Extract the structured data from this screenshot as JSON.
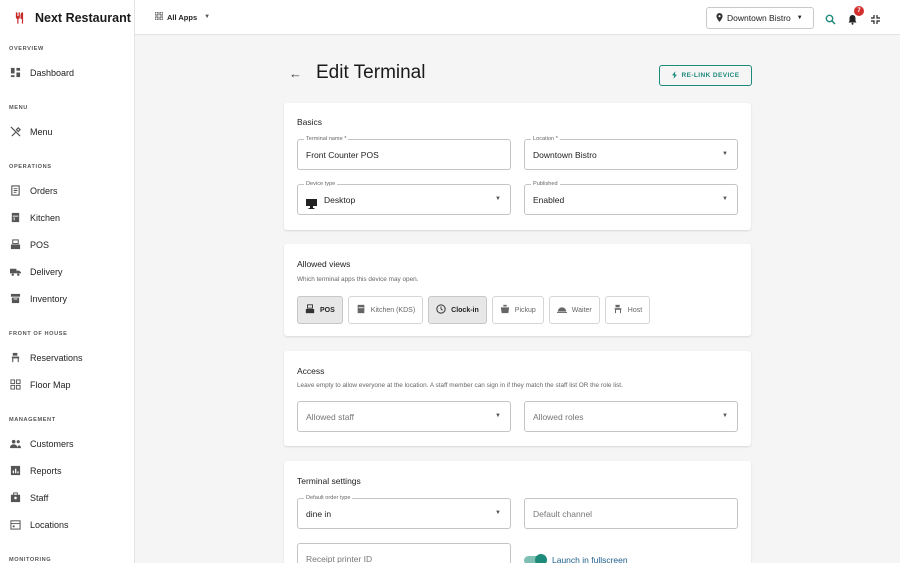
{
  "app": {
    "name": "Next Restaurant"
  },
  "topbar": {
    "apps_label": "All Apps",
    "location": "Downtown Bistro",
    "notifications_count": "7"
  },
  "sidebar": {
    "sections": [
      {
        "label": "OVERVIEW",
        "items": [
          {
            "label": "Dashboard",
            "icon": "dashboard-icon"
          }
        ]
      },
      {
        "label": "MENU",
        "items": [
          {
            "label": "Menu",
            "icon": "utensils-icon"
          }
        ]
      },
      {
        "label": "OPERATIONS",
        "items": [
          {
            "label": "Orders",
            "icon": "receipt-icon"
          },
          {
            "label": "Kitchen",
            "icon": "kitchen-icon"
          },
          {
            "label": "POS",
            "icon": "pos-icon"
          },
          {
            "label": "Delivery",
            "icon": "truck-icon"
          },
          {
            "label": "Inventory",
            "icon": "inventory-icon"
          }
        ]
      },
      {
        "label": "FRONT OF HOUSE",
        "items": [
          {
            "label": "Reservations",
            "icon": "reservation-icon"
          },
          {
            "label": "Floor Map",
            "icon": "floor-map-icon"
          }
        ]
      },
      {
        "label": "MANAGEMENT",
        "items": [
          {
            "label": "Customers",
            "icon": "customers-icon"
          },
          {
            "label": "Reports",
            "icon": "reports-icon"
          },
          {
            "label": "Staff",
            "icon": "staff-icon"
          },
          {
            "label": "Locations",
            "icon": "locations-icon"
          }
        ]
      },
      {
        "label": "MONITORING",
        "items": []
      }
    ]
  },
  "page": {
    "title": "Edit Terminal",
    "relink_label": "RE-LINK DEVICE"
  },
  "basics": {
    "title": "Basics",
    "terminal_name_label": "Terminal name *",
    "terminal_name_value": "Front Counter POS",
    "location_label": "Location *",
    "location_value": "Downtown Bistro",
    "device_type_label": "Device type",
    "device_type_value": "Desktop",
    "published_label": "Published",
    "published_value": "Enabled"
  },
  "allowed_views": {
    "title": "Allowed views",
    "subtitle": "Which terminal apps this device may open.",
    "options": [
      {
        "label": "POS",
        "icon": "pos-icon",
        "selected": true
      },
      {
        "label": "Kitchen (KDS)",
        "icon": "kitchen-icon",
        "selected": false
      },
      {
        "label": "Clock-in",
        "icon": "clock-icon",
        "selected": true
      },
      {
        "label": "Pickup",
        "icon": "pickup-icon",
        "selected": false
      },
      {
        "label": "Waiter",
        "icon": "cloche-icon",
        "selected": false
      },
      {
        "label": "Host",
        "icon": "host-icon",
        "selected": false
      }
    ]
  },
  "access": {
    "title": "Access",
    "subtitle": "Leave empty to allow everyone at the location. A staff member can sign in if they match the staff list OR the role list.",
    "staff_placeholder": "Allowed staff",
    "roles_placeholder": "Allowed roles"
  },
  "terminal_settings": {
    "title": "Terminal settings",
    "order_type_label": "Default order type",
    "order_type_value": "dine in",
    "channel_placeholder": "Default channel",
    "printer_placeholder": "Receipt printer ID",
    "fullscreen_label": "Launch in fullscreen",
    "fullscreen_on": true
  },
  "colors": {
    "accent": "#1e8a7a",
    "badge": "#d32f2f"
  }
}
